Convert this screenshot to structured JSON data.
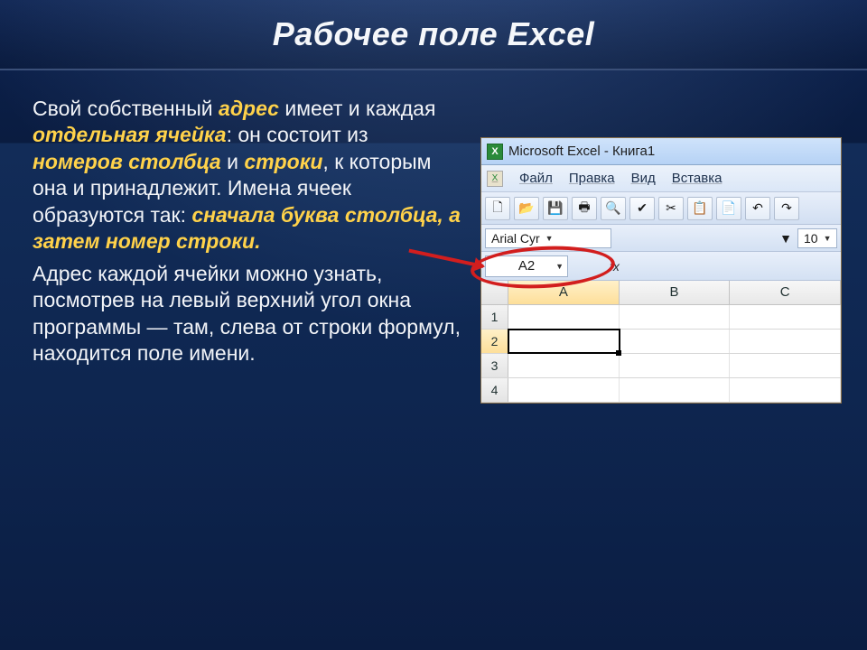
{
  "title": "Рабочее поле Excel",
  "text": {
    "p1a": "Свой собственный ",
    "p1_hl1": "адрес",
    "p1b": " имеет и каждая ",
    "p1_hl2": "отдельная ячейка",
    "p1c": ": он состоит из ",
    "p1_hl3": "номеров столбца",
    "p1d": " и ",
    "p1_hl4": "строки",
    "p1e": ", к которым она и принадлежит. Имена ячеек образуются так: ",
    "p1_hl5": "сначала буква столбца, а затем номер строки.",
    "p2": "Адрес каждой ячейки можно узнать, посмотрев на левый верхний угол окна программы — там, слева от строки формул, находится поле имени."
  },
  "excel": {
    "title": "Microsoft Excel - Книга1",
    "menu": {
      "file": "Файл",
      "edit": "Правка",
      "view": "Вид",
      "insert": "Вставка"
    },
    "font": {
      "name": "Arial Cyr",
      "size": "10"
    },
    "namebox": "A2",
    "fx_label": "fx",
    "cols": [
      "A",
      "B",
      "C"
    ],
    "rows": [
      "1",
      "2",
      "3",
      "4"
    ],
    "selected_row": 2,
    "selected_col": 1
  }
}
